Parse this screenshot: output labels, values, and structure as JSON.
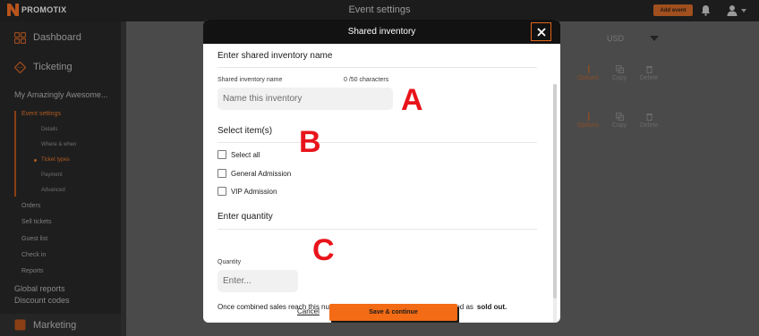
{
  "app": {
    "logo_text": "PROMOTIX",
    "window_title": "Event settings",
    "add_event_label": "Add event"
  },
  "sidebar": {
    "dashboard_label": "Dashboard",
    "ticketing_label": "Ticketing",
    "event_name": "My Amazingly Awesome...",
    "event_settings_label": "Event settings",
    "event_settings_items": [
      "Details",
      "Where & when",
      "Ticket types",
      "Payment",
      "Advanced"
    ],
    "event_items": [
      "Orders",
      "Sell tickets",
      "Guest list",
      "Check in",
      "Reports"
    ],
    "global_reports_label": "Global reports",
    "discount_codes_label": "Discount codes",
    "marketing_label": "Marketing"
  },
  "background": {
    "currency_value": "USD",
    "row_actions": [
      {
        "options": "Options",
        "copy": "Copy",
        "delete": "Delete"
      },
      {
        "options": "Options",
        "copy": "Copy",
        "delete": "Delete"
      }
    ]
  },
  "modal": {
    "title": "Shared inventory",
    "close_icon": "close-icon",
    "name_section_title": "Enter shared inventory name",
    "name_field_label": "Shared inventory name",
    "name_char_count": "0 /50 characters",
    "name_placeholder": "Name this inventory",
    "items_section_title": "Select item(s)",
    "items": [
      "Select all",
      "General Admission",
      "VIP Admission"
    ],
    "quantity_section_title": "Enter quantity",
    "quantity_label": "Quantity",
    "quantity_placeholder": "Enter...",
    "note_text": "Once combined sales reach this number, the selected items will all be marked as",
    "note_bold": "sold out.",
    "cancel_label": "Cancel",
    "save_label": "Save & continue"
  },
  "annotations": {
    "a": "A",
    "b": "B",
    "c": "C"
  },
  "colors": {
    "accent": "#f36b14",
    "modal_header": "#121212",
    "annotation": "#e8141b"
  }
}
